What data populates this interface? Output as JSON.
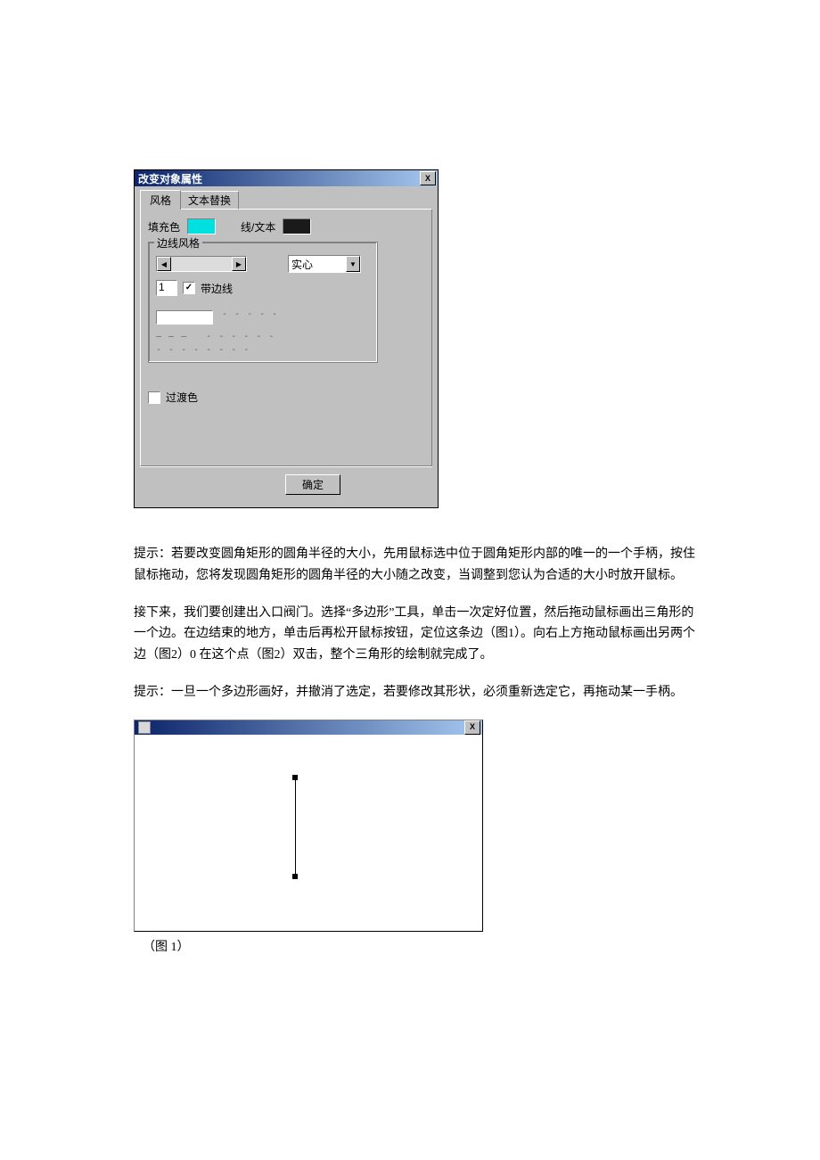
{
  "dialog": {
    "title": "改变对象属性",
    "close": "X",
    "tab_style": "风格",
    "tab_replace": "文本替换",
    "fill_label": "填充色",
    "line_text_label": "线/文本",
    "group_title": "边线风格",
    "combo_value": "实心",
    "width_value": "1",
    "with_border": "带边线",
    "gradient": "过渡色",
    "ok": "确定"
  },
  "paragraphs": {
    "p1": "提示：若要改变圆角矩形的圆角半径的大小，先用鼠标选中位于圆角矩形内部的唯一的一个手柄，按住鼠标拖动，您将发现圆角矩形的圆角半径的大小随之改变，当调整到您认为合适的大小时放开鼠标。",
    "p2": "接下来，我们要创建出入口阀门。选择“多边形”工具，单击一次定好位置，然后拖动鼠标画出三角形的一个边。在边结束的地方，单击后再松开鼠标按钮，定位这条边（图1）。向右上方拖动鼠标画出另两个边（图2）0 在这个点（图2）双击，整个三角形的绘制就完成了。",
    "p3": "提示：一旦一个多边形画好，并撤消了选定，若要修改其形状，必须重新选定它，再拖动某一手柄。"
  },
  "figure2": {
    "close": "X",
    "caption": "（图 1）"
  }
}
